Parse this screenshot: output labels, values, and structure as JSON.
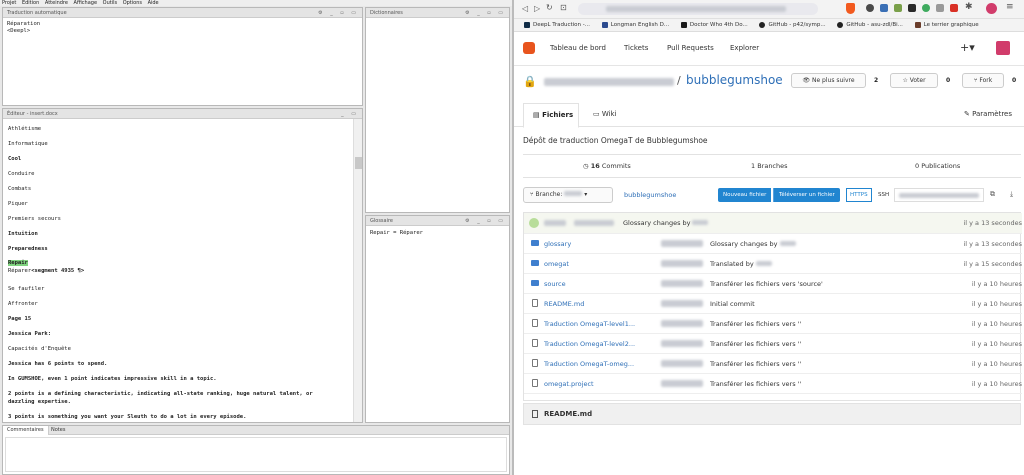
{
  "omegat": {
    "menu": [
      "Projet",
      "Édition",
      "Atteindre",
      "Affichage",
      "Outils",
      "Options",
      "Aide"
    ],
    "panes": {
      "mt": {
        "title": "Traduction automatique",
        "lines": [
          "Réparation",
          "<Deepl>"
        ]
      },
      "dict": {
        "title": "Dictionnaires"
      },
      "editor": {
        "title": "Éditeur - insert.docx"
      },
      "glossary": {
        "title": "Glossaire",
        "entry": "Repair = Réparer"
      }
    },
    "editor_lines": [
      {
        "text": "Athlétisme",
        "bold": false
      },
      {
        "text": "Informatique",
        "bold": false
      },
      {
        "text": "Cool",
        "bold": true
      },
      {
        "text": "Conduire",
        "bold": false
      },
      {
        "text": "Combats",
        "bold": false
      },
      {
        "text": "Piquer",
        "bold": false
      },
      {
        "text": "Premiers secours",
        "bold": false
      },
      {
        "text": "Intuition",
        "bold": true
      },
      {
        "text": "Preparedness",
        "bold": true
      }
    ],
    "active_segment": {
      "source": "Repair",
      "target": "Réparer",
      "marker": "<segment 4935 ¶>"
    },
    "editor_lines2": [
      {
        "text": "Se faufiler",
        "bold": false
      },
      {
        "text": "Affronter",
        "bold": false
      },
      {
        "text": "Page 15",
        "bold": true
      },
      {
        "text": "Jessica Park:",
        "bold": true
      },
      {
        "text": "Capacités d'Enquête",
        "bold": false
      },
      {
        "text": "Jessica has 6 points to spend.",
        "bold": true
      },
      {
        "text": "In GUMSHOE, even 1 point indicates impressive skill in a topic.",
        "bold": true
      },
      {
        "text": "2 points is a defining characteristic, indicating all-state ranking, huge natural talent, or",
        "bold": true
      },
      {
        "text": "dazzling expertise.",
        "bold": true
      },
      {
        "text": "3 points is something you want your Sleuth to do a lot in every episode.",
        "bold": true
      }
    ],
    "bottom_tabs": [
      "Commentaires",
      "Notes"
    ]
  },
  "browser": {
    "bookmarks": [
      "DeepL Traduction -...",
      "Longman English D...",
      "Doctor Who 4th Do...",
      "GitHub - p42/symp...",
      "GitHub - asu-zdl/Bi...",
      "Le terrier graphique"
    ],
    "nav": [
      "Tableau de bord",
      "Tickets",
      "Pull Requests",
      "Explorer"
    ],
    "repo": {
      "separator": "/",
      "name": "bubblegumshoe",
      "watch_label": "Ne plus suivre",
      "watch_count": "2",
      "star_label": "Voter",
      "star_count": "0",
      "fork_label": "Fork",
      "fork_count": "0",
      "tabs": {
        "files": "Fichiers",
        "wiki": "Wiki",
        "settings": "Paramètres"
      },
      "description": "Dépôt de traduction OmegaT de Bubblegumshoe",
      "stats": {
        "commits": "16 Commits",
        "commits_num": "16",
        "branches": "1 Branches",
        "releases": "0 Publications"
      },
      "branch_label": "Branche:",
      "path": "bubblegumshoe",
      "new_file": "Nouveau fichier",
      "upload": "Téléverser un fichier",
      "https": "HTTPS",
      "ssh": "SSH",
      "last_commit": {
        "message": "Glossary changes by",
        "time": "il y a 13 secondes"
      },
      "files": [
        {
          "name": "glossary",
          "type": "folder",
          "message": "Glossary changes by",
          "time": "il y a 13 secondes"
        },
        {
          "name": "omegat",
          "type": "folder",
          "message": "Translated by",
          "time": "il y a 15 secondes"
        },
        {
          "name": "source",
          "type": "folder",
          "message": "Transférer les fichiers vers 'source'",
          "time": "il y a 10 heures"
        },
        {
          "name": "README.md",
          "type": "file",
          "message": "Initial commit",
          "time": "il y a 10 heures"
        },
        {
          "name": "Traduction OmegaT-level1...",
          "type": "file",
          "message": "Transférer les fichiers vers ''",
          "time": "il y a 10 heures"
        },
        {
          "name": "Traduction OmegaT-level2...",
          "type": "file",
          "message": "Transférer les fichiers vers ''",
          "time": "il y a 10 heures"
        },
        {
          "name": "Traduction OmegaT-omeg...",
          "type": "file",
          "message": "Transférer les fichiers vers ''",
          "time": "il y a 10 heures"
        },
        {
          "name": "omegat.project",
          "type": "file",
          "message": "Transférer les fichiers vers ''",
          "time": "il y a 10 heures"
        }
      ],
      "readme_title": "README.md"
    },
    "icons": {
      "back": "back-icon",
      "forward": "forward-icon",
      "reload": "reload-icon",
      "bookmark": "bookmark-icon",
      "brave": "brave-shield-icon",
      "extensions": "puzzle-icon",
      "menu": "menu-icon"
    },
    "colors": {
      "gitea_orange": "#e8541d",
      "link": "#2e6fb7",
      "primary_btn": "#2185d0"
    }
  }
}
